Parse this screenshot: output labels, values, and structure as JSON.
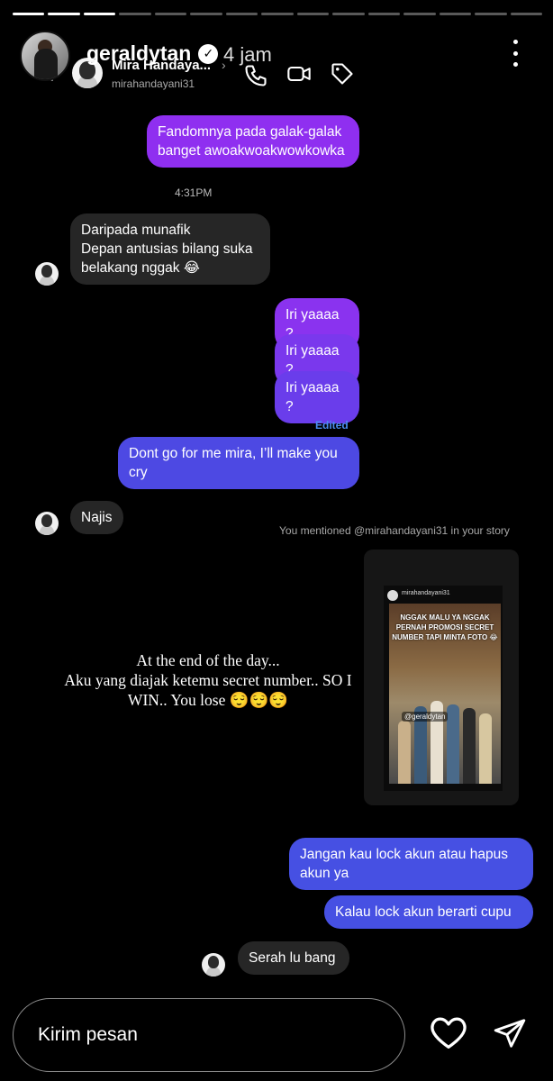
{
  "story": {
    "progress": [
      1,
      1,
      1,
      0,
      0,
      0,
      0,
      0,
      0,
      0,
      0,
      0,
      0,
      0,
      0
    ],
    "username": "geraldytan",
    "verified": true,
    "time": "4 jam"
  },
  "chat": {
    "header": {
      "back_icon": "chevron-left-icon",
      "name": "Mira Handaya...",
      "handle": "mirahandayani31",
      "chevron": "›",
      "icons": [
        "phone-icon",
        "video-camera-icon",
        "tag-icon"
      ]
    },
    "messages": [
      {
        "side": "sent",
        "color": "#8f2ff0",
        "text": "Fandomnya pada galak-galak banget awoakwoakwowkowka"
      },
      {
        "timestamp": "4:31PM"
      },
      {
        "side": "received",
        "text": "Daripada munafik\nDepan antusias bilang suka belakang nggak 😂"
      },
      {
        "side": "sent",
        "color": "#8f2ff0",
        "text": "Iri yaaaa ?"
      },
      {
        "side": "sent",
        "color": "#7e37ee",
        "text": "Iri yaaaa ?"
      },
      {
        "side": "sent",
        "color": "#6c3deb",
        "text": "Iri yaaaa ?"
      },
      {
        "status": "Edited"
      },
      {
        "side": "sent",
        "color": "#4d49e3",
        "text": "Dont go for me mira, I’ll make you cry"
      },
      {
        "side": "received",
        "text": "Najis"
      },
      {
        "mention": "You mentioned @mirahandayani31 in your story"
      },
      {
        "side": "sent",
        "color": "#4650e3",
        "text": "Jangan kau lock akun atau hapus akun ya"
      },
      {
        "side": "sent",
        "color": "#4650e3",
        "text": "Kalau lock akun berarti cupu"
      },
      {
        "side": "received",
        "text": "Serah lu bang"
      }
    ],
    "shared_story": {
      "username": "mirahandayani31",
      "caption": "NGGAK MALU YA NGGAK PERNAH PROMOSI SECRET NUMBER TAPI MINTA FOTO 😂",
      "tag": "@geraldytan"
    }
  },
  "story_text": "At the end of the day...\nAku yang diajak ketemu secret number.. SO I WIN.. You lose 😌😌😌",
  "reply_bar": {
    "placeholder": "Kirim pesan",
    "icons": [
      "heart-icon",
      "send-icon"
    ]
  }
}
